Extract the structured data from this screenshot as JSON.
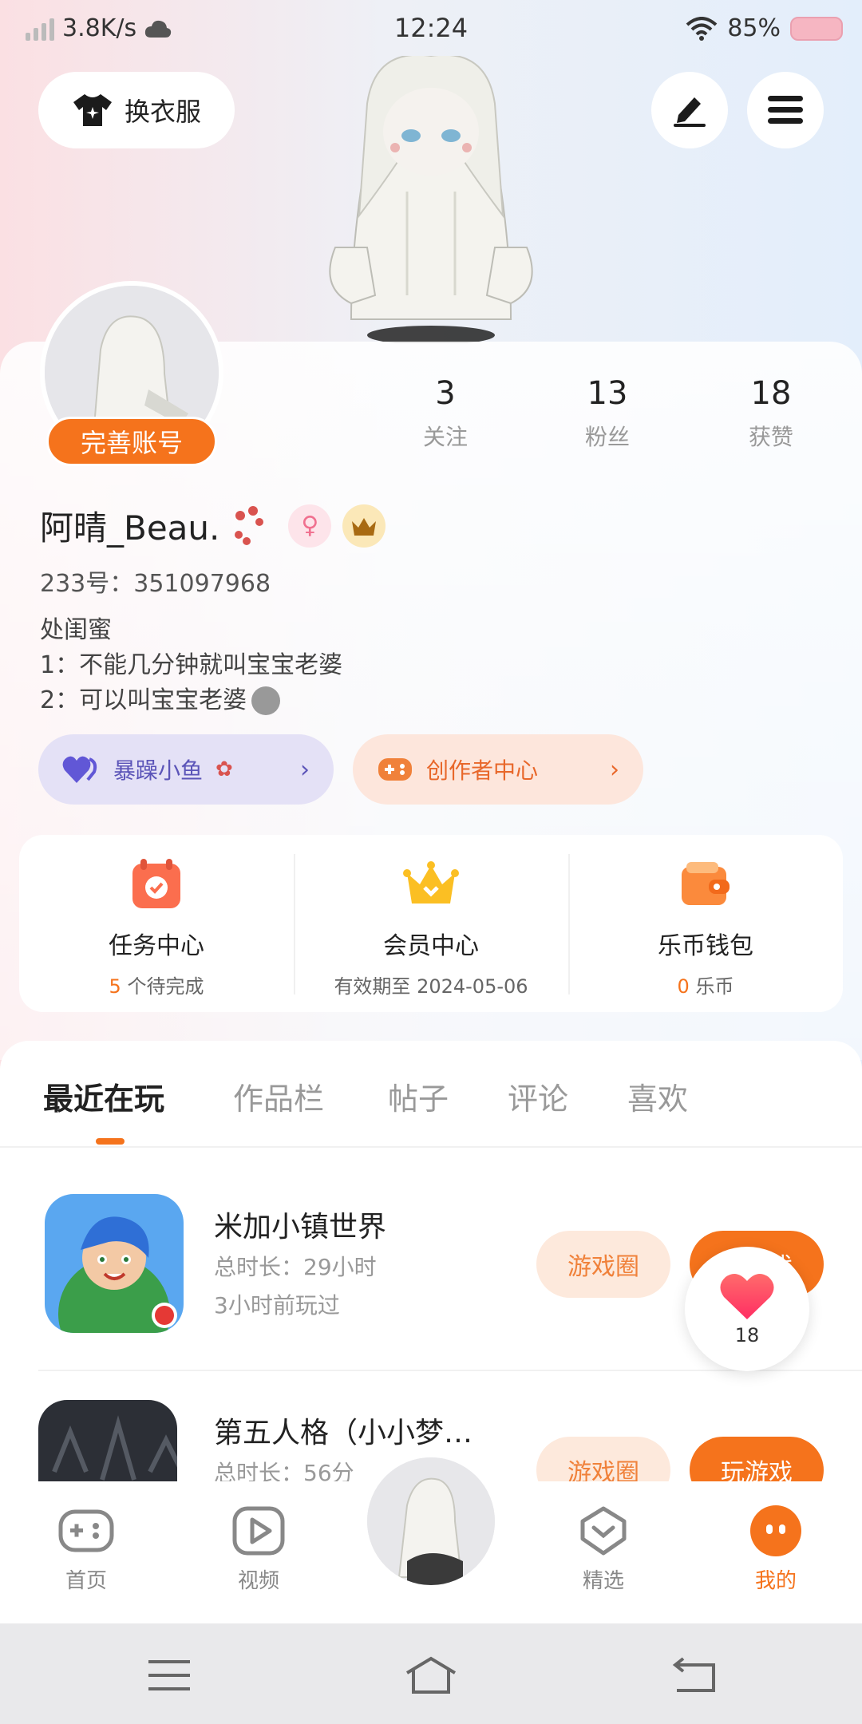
{
  "status_bar": {
    "net_speed": "3.8K/s",
    "time": "12:24",
    "battery": "85%"
  },
  "header": {
    "dress_button": "换衣服",
    "edit_icon": "pencil-icon",
    "menu_icon": "hamburger-icon"
  },
  "profile": {
    "complete_button": "完善账号",
    "stats": [
      {
        "value": "3",
        "label": "关注"
      },
      {
        "value": "13",
        "label": "粉丝"
      },
      {
        "value": "18",
        "label": "获赞"
      }
    ],
    "username": "阿晴_Beau.",
    "uid": "233号：351097968",
    "bio": [
      "处闺蜜",
      "1：不能几分钟就叫宝宝老婆",
      "2：可以叫宝宝老婆"
    ],
    "pills": {
      "fish": "暴躁小鱼",
      "creator": "创作者中心"
    }
  },
  "services": [
    {
      "title": "任务中心",
      "highlight": "5",
      "sub": " 个待完成",
      "icon": "calendar-check-icon"
    },
    {
      "title": "会员中心",
      "highlight": "",
      "sub": "有效期至 2024-05-06",
      "icon": "crown-icon"
    },
    {
      "title": "乐币钱包",
      "highlight": "0",
      "sub": " 乐币",
      "icon": "wallet-icon"
    }
  ],
  "tabs": [
    "最近在玩",
    "作品栏",
    "帖子",
    "评论",
    "喜欢"
  ],
  "games": [
    {
      "title": "米加小镇世界",
      "duration": "总时长：29小时",
      "last_played": "3小时前玩过",
      "circle_label": "游戏圈",
      "play_label": "玩游戏"
    },
    {
      "title": "第五人格（小小梦…",
      "duration": "总时长：56分",
      "circle_label": "游戏圈",
      "play_label": "玩游戏"
    }
  ],
  "like_float": {
    "count": "18"
  },
  "bottom_nav": [
    {
      "label": "首页",
      "icon": "gamepad-icon"
    },
    {
      "label": "视频",
      "icon": "play-icon"
    },
    {
      "label": "精选",
      "icon": "heart-box-icon"
    },
    {
      "label": "我的",
      "icon": "me-icon",
      "active": true
    }
  ],
  "colors": {
    "accent": "#f5731c",
    "purple": "#5b54b8"
  }
}
